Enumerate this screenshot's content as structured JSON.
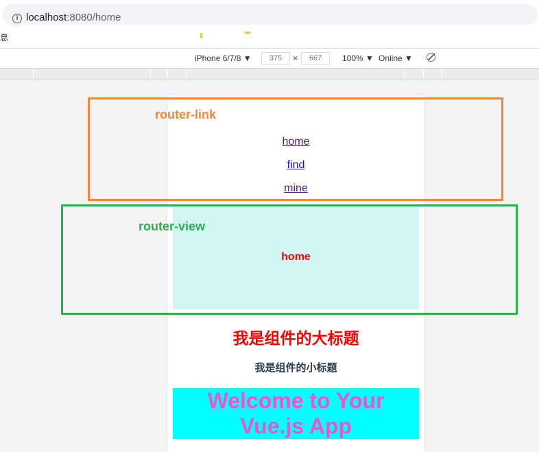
{
  "browser": {
    "url_host": "localhost",
    "url_rest": ":8080/home",
    "bookmarks_label": "息"
  },
  "devtools": {
    "device": "iPhone 6/7/8 ▼",
    "width": "375",
    "height": "667",
    "x_sep": "×",
    "zoom": "100% ▼",
    "network": "Online ▼",
    "rotate_icon": "rotate-icon"
  },
  "app": {
    "nav_links": [
      "home",
      "find",
      "mine"
    ],
    "view_text": "home",
    "big_title": "我是组件的大标题",
    "small_title": "我是组件的小标题",
    "welcome_line1": "Welcome to Your",
    "welcome_line2": "Vue.js App"
  },
  "annotations": {
    "router_link": "router-link",
    "router_view": "router-view"
  },
  "colors": {
    "link_annotation": "#f5853a",
    "view_annotation": "#2bb04a",
    "view_bg": "#d2f6f4",
    "title_red": "#ff0000",
    "welcome_bg": "#00ffff",
    "welcome_text": "#ee55cc"
  }
}
